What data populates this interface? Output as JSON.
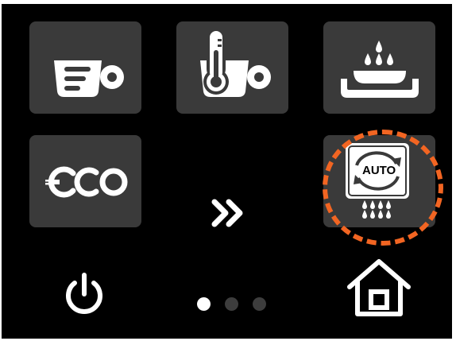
{
  "tiles": {
    "coffee": {
      "icon": "coffee-cup-icon"
    },
    "temperature": {
      "icon": "cup-thermometer-icon"
    },
    "hot_water": {
      "icon": "hot-water-drops-icon"
    },
    "eco": {
      "label": "eco",
      "icon": "eco-plug-icon"
    },
    "auto_rinse": {
      "label": "AUTO",
      "icon": "auto-rinse-cycle-icon"
    }
  },
  "controls": {
    "next_icon": "double-chevron-right-icon",
    "power_icon": "power-icon",
    "home_icon": "home-icon"
  },
  "pagination": {
    "total": 3,
    "active": 1
  },
  "colors": {
    "background": "#000000",
    "tile": "#3a3a3a",
    "icon": "#ffffff",
    "highlight": "#f26522",
    "dot_active": "#ffffff",
    "dot_inactive": "#3d3d3d"
  }
}
